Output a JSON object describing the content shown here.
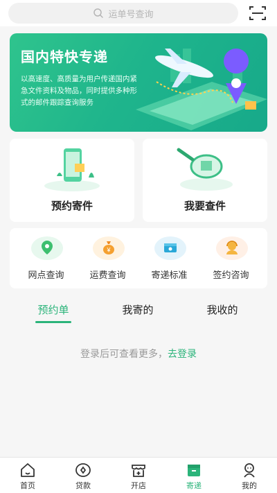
{
  "search": {
    "placeholder": "运单号查询"
  },
  "banner": {
    "title": "国内特快专递",
    "description": "以高速度、高质量为用户传递国内紧急文件资料及物品，同时提供多种形式的邮件跟踪查询服务",
    "slide_count": 4,
    "active_slide": 1
  },
  "cards": [
    {
      "label": "预约寄件"
    },
    {
      "label": "我要查件"
    }
  ],
  "services": [
    {
      "label": "网点查询",
      "icon": "location-pin-icon"
    },
    {
      "label": "运费查询",
      "icon": "money-bag-icon"
    },
    {
      "label": "寄递标准",
      "icon": "package-icon"
    },
    {
      "label": "签约咨询",
      "icon": "customer-service-icon"
    }
  ],
  "tabs": [
    {
      "label": "预约单",
      "active": true
    },
    {
      "label": "我寄的",
      "active": false
    },
    {
      "label": "我收的",
      "active": false
    }
  ],
  "login_hint": {
    "text": "登录后可查看更多，",
    "link": "去登录"
  },
  "bottom_nav": [
    {
      "label": "首页",
      "icon": "home-icon"
    },
    {
      "label": "贷款",
      "icon": "loan-icon"
    },
    {
      "label": "开店",
      "icon": "shop-icon"
    },
    {
      "label": "寄递",
      "icon": "delivery-icon",
      "active": true
    },
    {
      "label": "我的",
      "icon": "profile-icon"
    }
  ],
  "colors": {
    "accent": "#2bb47a",
    "banner": "#1fb58c"
  }
}
